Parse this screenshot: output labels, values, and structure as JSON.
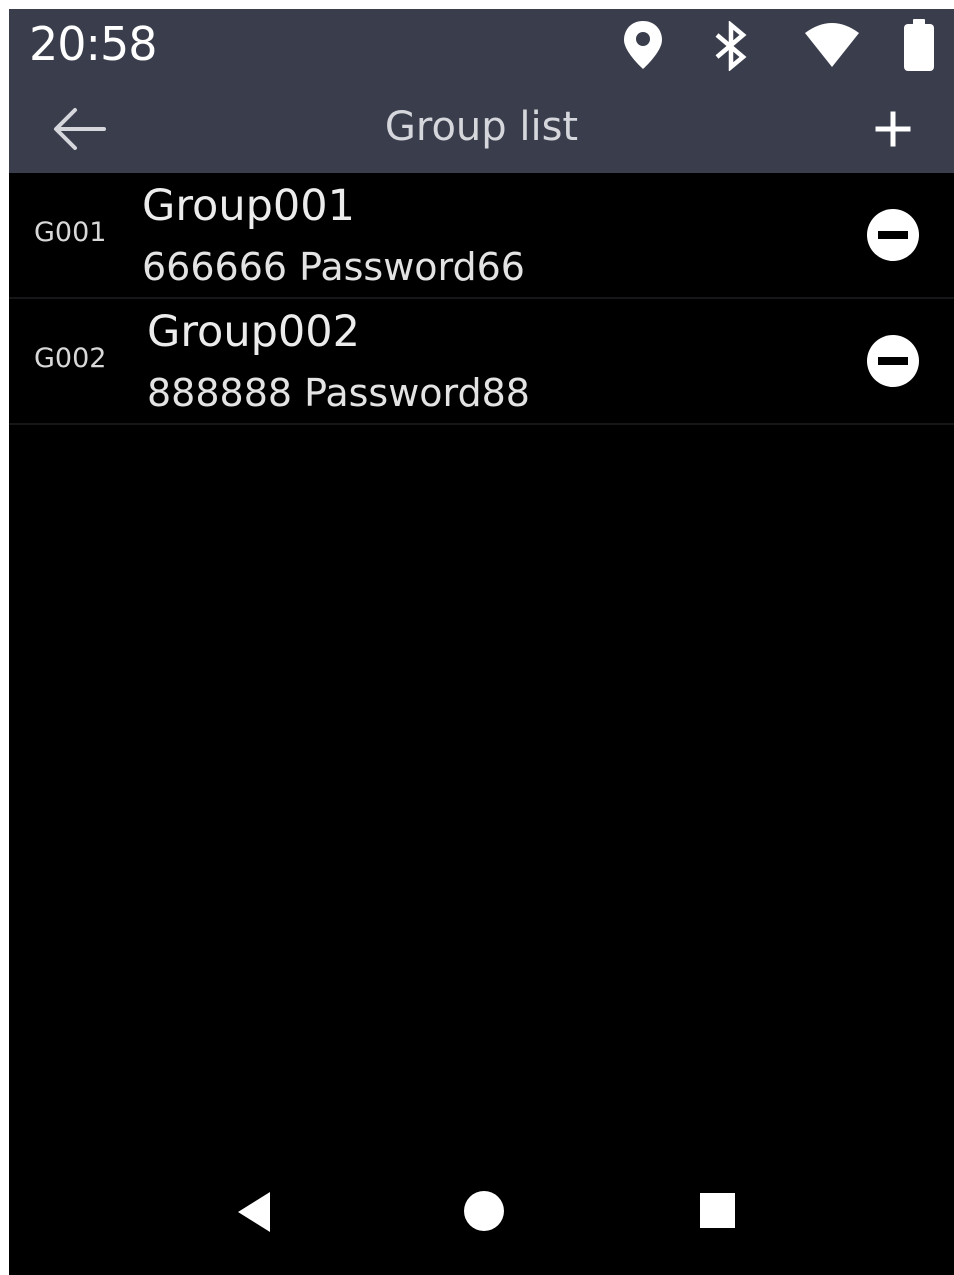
{
  "status_bar": {
    "time": "20:58",
    "icons": [
      "location-icon",
      "bluetooth-icon",
      "wifi-icon",
      "battery-icon"
    ]
  },
  "title_bar": {
    "title": "Group list",
    "back_icon": "arrow-left-icon",
    "add_icon": "plus-icon"
  },
  "groups": [
    {
      "code": "G001",
      "name": "Group001",
      "detail": "666666 Password66",
      "action_icon": "remove-circle-icon"
    },
    {
      "code": "G002",
      "name": "Group002",
      "detail": "888888 Password88",
      "action_icon": "remove-circle-icon"
    }
  ],
  "nav_bar": {
    "icons": [
      "nav-back-icon",
      "nav-home-icon",
      "nav-recents-icon"
    ]
  },
  "colors": {
    "bar_background": "#3a3e4c",
    "screen_background": "#000000",
    "text": "#ececec"
  }
}
